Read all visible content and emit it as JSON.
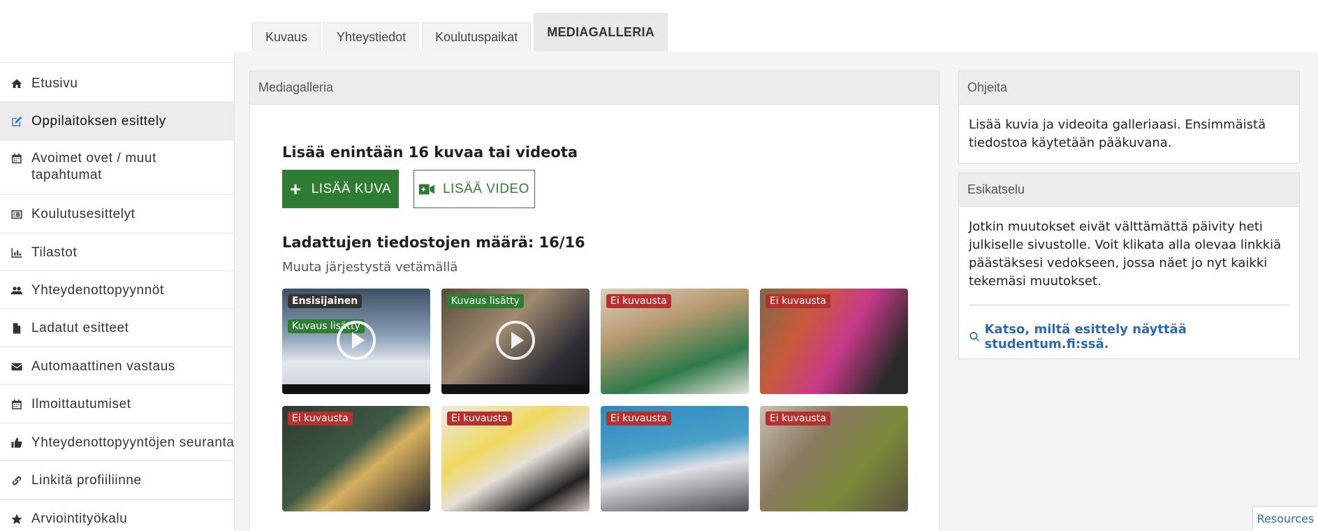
{
  "tabs": [
    {
      "label": "Kuvaus"
    },
    {
      "label": "Yhteystiedot"
    },
    {
      "label": "Koulutuspaikat"
    },
    {
      "label": "MEDIAGALLERIA",
      "active": true
    }
  ],
  "sidebar": {
    "items": [
      {
        "label": "Etusivu",
        "icon": "home-icon"
      },
      {
        "label": "Oppilaitoksen esittely",
        "icon": "edit-icon",
        "active": true
      },
      {
        "label": "Avoimet ovet / muut tapahtumat",
        "icon": "calendar-icon"
      },
      {
        "label": "Koulutusesittelyt",
        "icon": "list-icon"
      },
      {
        "label": "Tilastot",
        "icon": "bar-chart-icon"
      },
      {
        "label": "Yhteydenottopyynnöt",
        "icon": "users-icon"
      },
      {
        "label": "Ladatut esitteet",
        "icon": "file-icon"
      },
      {
        "label": "Automaattinen vastaus",
        "icon": "envelope-icon"
      },
      {
        "label": "Ilmoittautumiset",
        "icon": "calendar-icon"
      },
      {
        "label": "Yhteydenottopyyntöjen seuranta",
        "icon": "thumbs-up-icon"
      },
      {
        "label": "Linkitä profiiliinne",
        "icon": "link-icon"
      },
      {
        "label": "Arviointityökalu",
        "icon": "star-icon"
      }
    ]
  },
  "gallery": {
    "header": "Mediagalleria",
    "title": "Lisää enintään 16 kuvaa tai videota",
    "add_image_label": "LISÄÄ KUVA",
    "add_video_label": "LISÄÄ VIDEO",
    "count_label": "Ladattujen tiedostojen määrä: 16/16",
    "hint": "Muuta järjestystä vetämällä",
    "thumbs": [
      {
        "badges": [
          "Ensisijainen",
          "Kuvaus lisätty"
        ],
        "video": true
      },
      {
        "badges": [
          "Kuvaus lisätty"
        ],
        "video": true
      },
      {
        "badges": [
          "Ei kuvausta"
        ],
        "video": false
      },
      {
        "badges": [
          "Ei kuvausta"
        ],
        "video": false
      },
      {
        "badges": [
          "Ei kuvausta"
        ],
        "video": false
      },
      {
        "badges": [
          "Ei kuvausta"
        ],
        "video": false
      },
      {
        "badges": [
          "Ei kuvausta"
        ],
        "video": false
      },
      {
        "badges": [
          "Ei kuvausta"
        ],
        "video": false
      }
    ]
  },
  "instructions": {
    "header": "Ohjeita",
    "text": "Lisää kuvia ja videoita galleriaasi. Ensimmäistä tiedostoa käytetään pääkuvana."
  },
  "preview": {
    "header": "Esikatselu",
    "text": "Jotkin muutokset eivät välttämättä päivity heti julkiselle sivustolle. Voit klikata alla olevaa linkkiä päästäksesi vedokseen, jossa näet jo nyt kaikki tekemäsi muutokset.",
    "link_label": "Katso, miltä esittely näyttää studentum.fi:ssä."
  },
  "resources_label": "Resources"
}
